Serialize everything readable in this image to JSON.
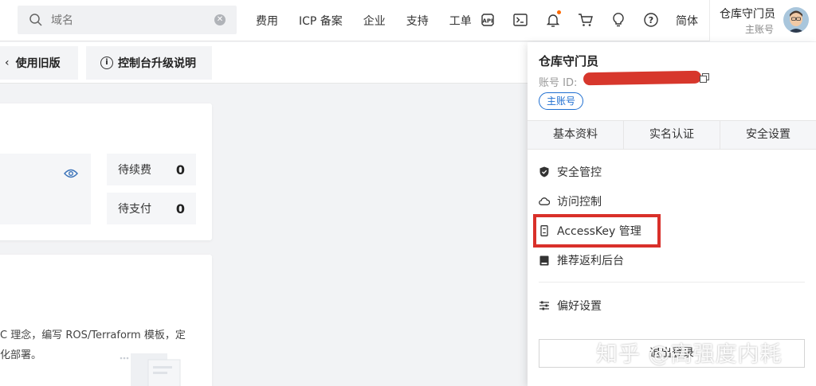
{
  "search": {
    "placeholder": "域名"
  },
  "nav": {
    "links": [
      "费用",
      "ICP 备案",
      "企业",
      "支持",
      "工单"
    ],
    "icons": [
      "api-icon",
      "terminal-icon",
      "bell-icon",
      "cart-icon",
      "lightbulb-icon",
      "help-icon"
    ],
    "language": "简体"
  },
  "user": {
    "name": "仓库守门员",
    "role": "主账号"
  },
  "subheader": {
    "old_version": "使用旧版",
    "upgrade_notes": "控制台升级说明"
  },
  "overview": {
    "stats": [
      {
        "label": "待续费",
        "value": "0"
      },
      {
        "label": "待支付",
        "value": "0"
      }
    ],
    "desc_line1": "C 理念，编写 ROS/Terraform 模板，定",
    "desc_line2": "化部署。"
  },
  "dropdown": {
    "name": "仓库守门员",
    "account_id_label": "账号 ID:",
    "badge": "主账号",
    "tabs": [
      "基本资料",
      "实名认证",
      "安全设置"
    ],
    "menu": [
      {
        "label": "安全管控",
        "icon": "shield-icon"
      },
      {
        "label": "访问控制",
        "icon": "cloud-icon"
      },
      {
        "label": "AccessKey 管理",
        "icon": "key-icon"
      },
      {
        "label": "推荐返利后台",
        "icon": "book-icon"
      },
      {
        "label": "偏好设置",
        "icon": "sliders-icon"
      }
    ],
    "logout": "退出登录"
  },
  "watermark": "知乎 @高强度内耗",
  "colors": {
    "accent_blue": "#1f6fd1",
    "highlight_red": "#d9302a",
    "notification_orange": "#ff6a00"
  }
}
